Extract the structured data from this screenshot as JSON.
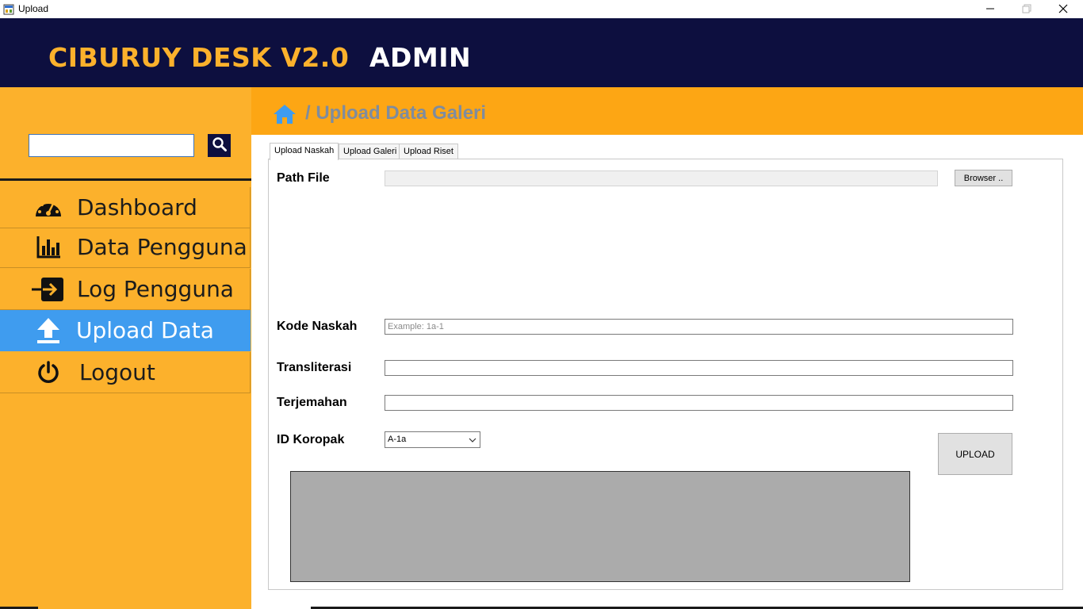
{
  "window": {
    "title": "Upload",
    "icons": {
      "app": "app-window-icon",
      "minimize": "minimize-icon",
      "maximize": "maximize-icon",
      "close": "close-icon"
    }
  },
  "header": {
    "brand": "CIBURUY DESK V2.0",
    "role": "ADMIN",
    "colors": {
      "background": "#0d0f3f",
      "brand": "#fcb12c",
      "role": "#ffffff"
    }
  },
  "sidebar": {
    "search": {
      "value": "",
      "placeholder": "",
      "icon": "search-icon"
    },
    "items": [
      {
        "label": "Dashboard",
        "icon": "dashboard-gauge-icon",
        "active": false
      },
      {
        "label": "Data Pengguna",
        "icon": "bar-chart-icon",
        "active": false
      },
      {
        "label": "Log Pengguna",
        "icon": "sign-in-icon",
        "active": false
      },
      {
        "label": "Upload Data",
        "icon": "upload-icon",
        "active": true
      },
      {
        "label": "Logout",
        "icon": "power-icon",
        "active": false
      }
    ],
    "colors": {
      "background": "#fcb12c",
      "active": "#3f9cef"
    }
  },
  "content": {
    "breadcrumb": "/ Upload Data Galeri",
    "home_icon": "home-icon",
    "tabs": [
      {
        "label": "Upload Naskah",
        "active": true
      },
      {
        "label": "Upload Galeri",
        "active": false
      },
      {
        "label": "Upload Riset",
        "active": false
      }
    ],
    "form": {
      "path_file_label": "Path File",
      "path_file_value": "",
      "browse_label": "Browser ..",
      "kode_naskah_label": "Kode Naskah",
      "kode_naskah_placeholder": "Example: 1a-1",
      "kode_naskah_value": "",
      "transliterasi_label": "Transliterasi",
      "transliterasi_value": "",
      "terjemahan_label": "Terjemahan",
      "terjemahan_value": "",
      "id_koropak_label": "ID Koropak",
      "id_koropak_selected": "A-1a",
      "upload_label": "UPLOAD"
    },
    "colors": {
      "header": "#fda614",
      "breadcrumb": "#7f8c9e",
      "home_icon": "#3f9cef",
      "preview": "#ababab"
    }
  }
}
